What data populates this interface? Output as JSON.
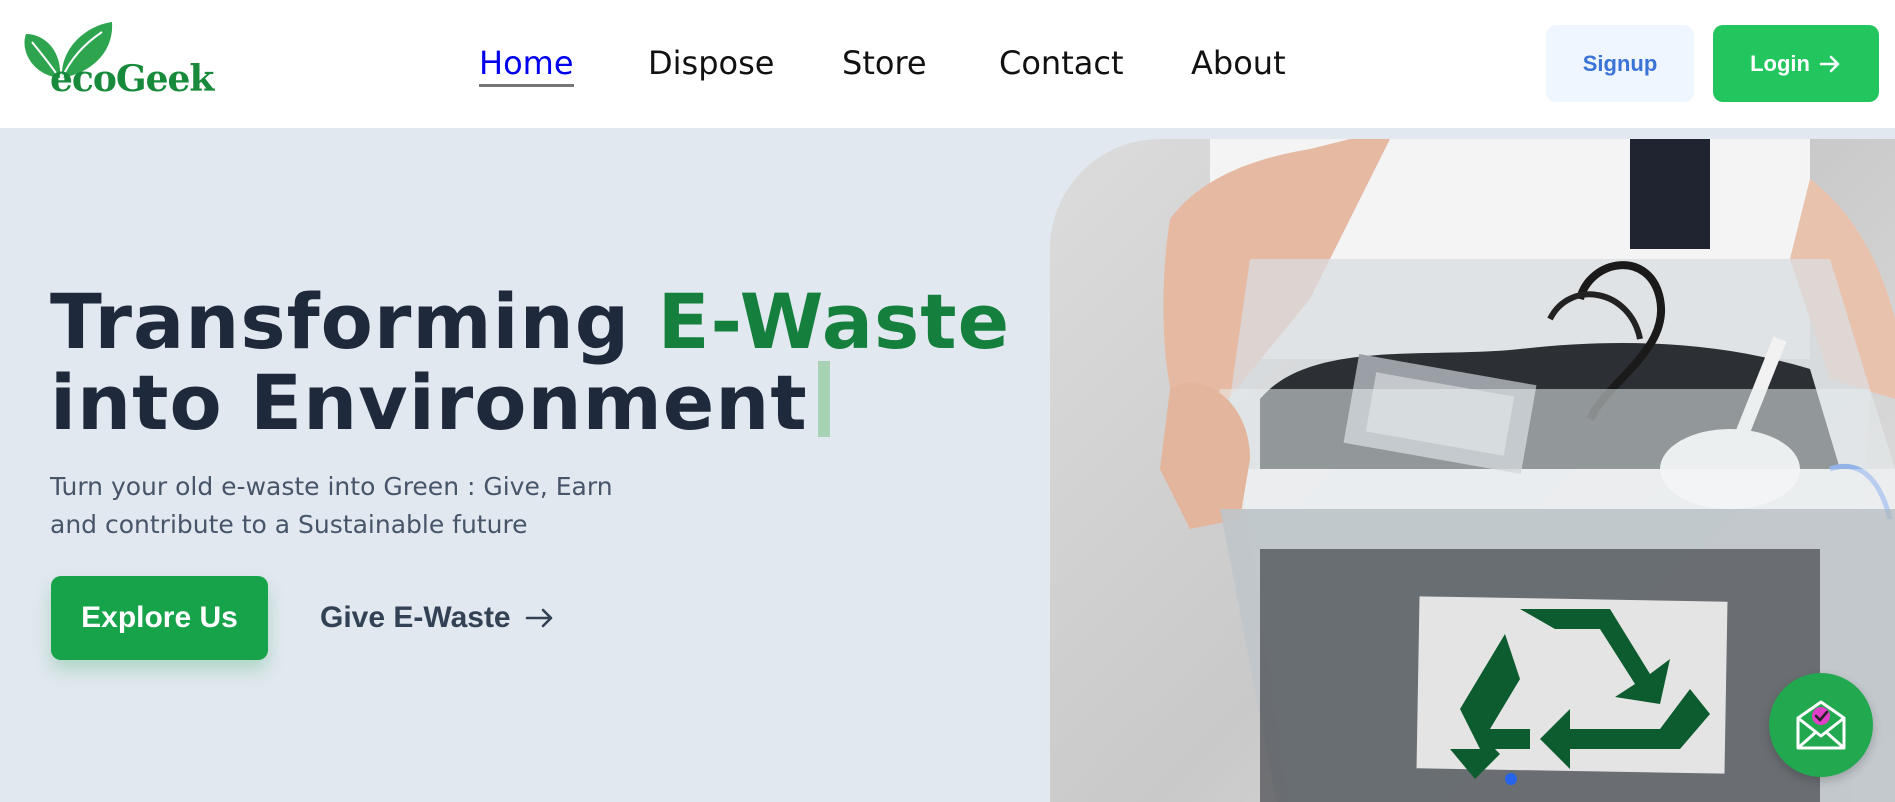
{
  "brand": {
    "name": "ecoGeek"
  },
  "nav": {
    "items": [
      {
        "label": "Home",
        "active": true
      },
      {
        "label": "Dispose",
        "active": false
      },
      {
        "label": "Store",
        "active": false
      },
      {
        "label": "Contact",
        "active": false
      },
      {
        "label": "About",
        "active": false
      }
    ]
  },
  "header": {
    "signup_label": "Signup",
    "login_label": "Login",
    "login_icon": "arrow-right-icon"
  },
  "hero": {
    "headline_part1": "Transforming ",
    "headline_accent": "E-Waste",
    "headline_part2": "into Environment",
    "subtext": "Turn your old e-waste into Green : Give, Earn and contribute to a Sustainable future",
    "explore_label": "Explore Us",
    "give_label": "Give E-Waste",
    "give_icon": "arrow-right-icon",
    "image_icon": "recycle-icon",
    "fab_icon": "mail-check-icon"
  },
  "colors": {
    "brand_green": "#16a34a",
    "accent_green": "#15803d",
    "login_green": "#22c55e",
    "signup_bg": "#eff6ff",
    "signup_text": "#3b74d6",
    "hero_bg": "#e2e8f0",
    "headline": "#1e293b"
  }
}
